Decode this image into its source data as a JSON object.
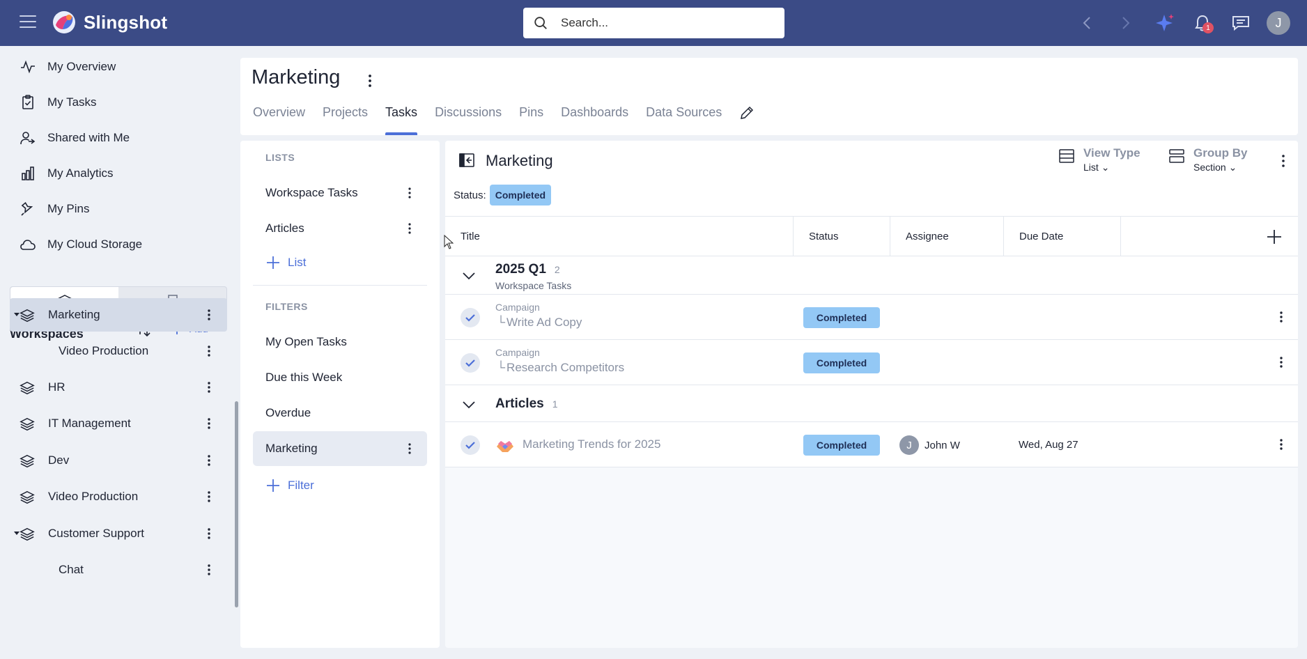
{
  "header": {
    "brand": "Slingshot",
    "search_placeholder": "Search...",
    "notification_count": "1",
    "user_initial": "J",
    "colors": {
      "bar": "#3b4b86",
      "accent": "#4c6fd8",
      "chip": "#93c8f5"
    }
  },
  "sidebar": {
    "nav": [
      {
        "label": "My Overview",
        "icon": "activity-icon"
      },
      {
        "label": "My Tasks",
        "icon": "clipboard-check-icon"
      },
      {
        "label": "Shared with Me",
        "icon": "user-share-icon"
      },
      {
        "label": "My Analytics",
        "icon": "bar-chart-icon"
      },
      {
        "label": "My Pins",
        "icon": "pin-icon"
      },
      {
        "label": "My Cloud Storage",
        "icon": "cloud-icon"
      }
    ],
    "workspaces_heading": "Workspaces",
    "add_label": "Add",
    "workspaces": [
      {
        "label": "Marketing"
      },
      {
        "label": "Video Production"
      },
      {
        "label": "HR"
      },
      {
        "label": "IT Management"
      },
      {
        "label": "Dev"
      },
      {
        "label": "Video Production"
      },
      {
        "label": "Customer Support"
      },
      {
        "label": "Chat"
      }
    ]
  },
  "workspace": {
    "title": "Marketing",
    "tabs": [
      "Overview",
      "Projects",
      "Tasks",
      "Discussions",
      "Pins",
      "Dashboards",
      "Data Sources"
    ],
    "active_tab": "Tasks"
  },
  "lists_panel": {
    "lists_heading": "LISTS",
    "lists": [
      "Workspace Tasks",
      "Articles"
    ],
    "add_list_label": "List",
    "filters_heading": "FILTERS",
    "filters": [
      "My Open Tasks",
      "Due this Week",
      "Overdue",
      "Marketing"
    ],
    "add_filter_label": "Filter"
  },
  "tasks_panel": {
    "title": "Marketing",
    "view_type_label": "View Type",
    "view_type_value": "List",
    "group_by_label": "Group By",
    "group_by_value": "Section",
    "status_filter_label": "Status:",
    "status_filter_value": "Completed",
    "columns": [
      "Title",
      "Status",
      "Assignee",
      "Due Date"
    ],
    "groups": [
      {
        "name": "2025 Q1",
        "count": "2",
        "subtitle": "Workspace Tasks",
        "tasks": [
          {
            "parent": "Campaign",
            "name": "Write Ad Copy",
            "status": "Completed"
          },
          {
            "parent": "Campaign",
            "name": "Research Competitors",
            "status": "Completed"
          }
        ]
      },
      {
        "name": "Articles",
        "count": "1",
        "tasks": [
          {
            "name": "Marketing Trends for 2025",
            "status": "Completed",
            "assignee_initial": "J",
            "assignee": "John W",
            "due": "Wed, Aug 27",
            "icon": "handshake-icon"
          }
        ]
      }
    ]
  }
}
